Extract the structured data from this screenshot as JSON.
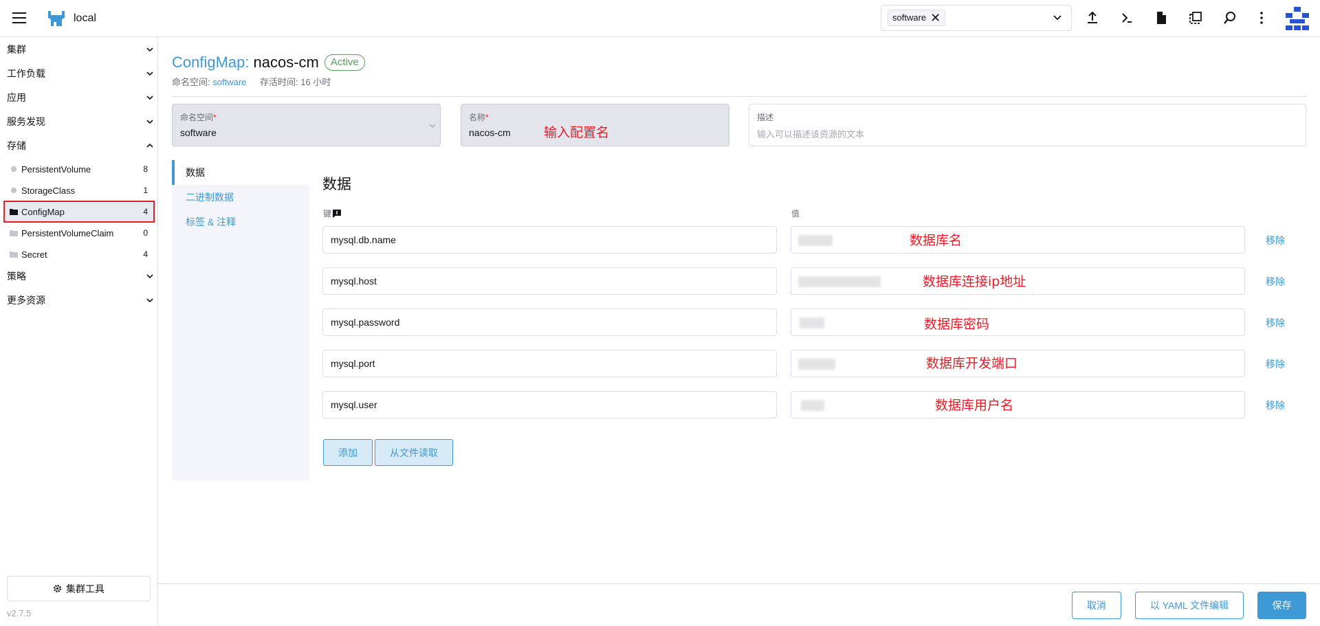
{
  "header": {
    "cluster_name": "local",
    "namespace_chip": "software",
    "chip_remove": "✕"
  },
  "sidebar": {
    "groups": [
      {
        "label": "集群"
      },
      {
        "label": "工作负载"
      },
      {
        "label": "应用"
      },
      {
        "label": "服务发现"
      },
      {
        "label": "存储"
      },
      {
        "label": "策略"
      },
      {
        "label": "更多资源"
      }
    ],
    "storage_items": [
      {
        "label": "PersistentVolume",
        "count": "8",
        "icon": "circle-icon"
      },
      {
        "label": "StorageClass",
        "count": "1",
        "icon": "circle-icon"
      },
      {
        "label": "ConfigMap",
        "count": "4",
        "icon": "folder-icon"
      },
      {
        "label": "PersistentVolumeClaim",
        "count": "0",
        "icon": "folder-icon"
      },
      {
        "label": "Secret",
        "count": "4",
        "icon": "folder-icon"
      }
    ],
    "tools_label": "集群工具",
    "version": "v2.7.5"
  },
  "page": {
    "type_label": "ConfigMap:",
    "name": "nacos-cm",
    "status": "Active",
    "namespace_label": "命名空间:",
    "namespace_value": "software",
    "age_label": "存活时间: 16 小时"
  },
  "form": {
    "namespace": {
      "label": "命名空间",
      "required": "*",
      "value": "software"
    },
    "name": {
      "label": "名称",
      "required": "*",
      "value": "nacos-cm"
    },
    "description": {
      "label": "描述",
      "placeholder": "输入可以描述该资源的文本"
    }
  },
  "annotations": {
    "name": "输入配置名",
    "rows": [
      "数据库名",
      "数据库连接ip地址",
      "数据库密码",
      "数据库开发端口",
      "数据库用户名"
    ]
  },
  "tabs": [
    {
      "label": "数据"
    },
    {
      "label": "二进制数据"
    },
    {
      "label": "标签 & 注释"
    }
  ],
  "data_section": {
    "title": "数据",
    "key_header": "键",
    "value_header": "值",
    "remove_label": "移除",
    "rows": [
      {
        "key": "mysql.db.name"
      },
      {
        "key": "mysql.host"
      },
      {
        "key": "mysql.password"
      },
      {
        "key": "mysql.port"
      },
      {
        "key": "mysql.user"
      }
    ],
    "add_label": "添加",
    "read_file_label": "从文件读取"
  },
  "footer": {
    "cancel": "取消",
    "yaml": "以 YAML 文件编辑",
    "save": "保存"
  },
  "colors": {
    "accent": "#3d98d3",
    "annotation_red": "#e41e26",
    "active_green": "#5d995d"
  }
}
